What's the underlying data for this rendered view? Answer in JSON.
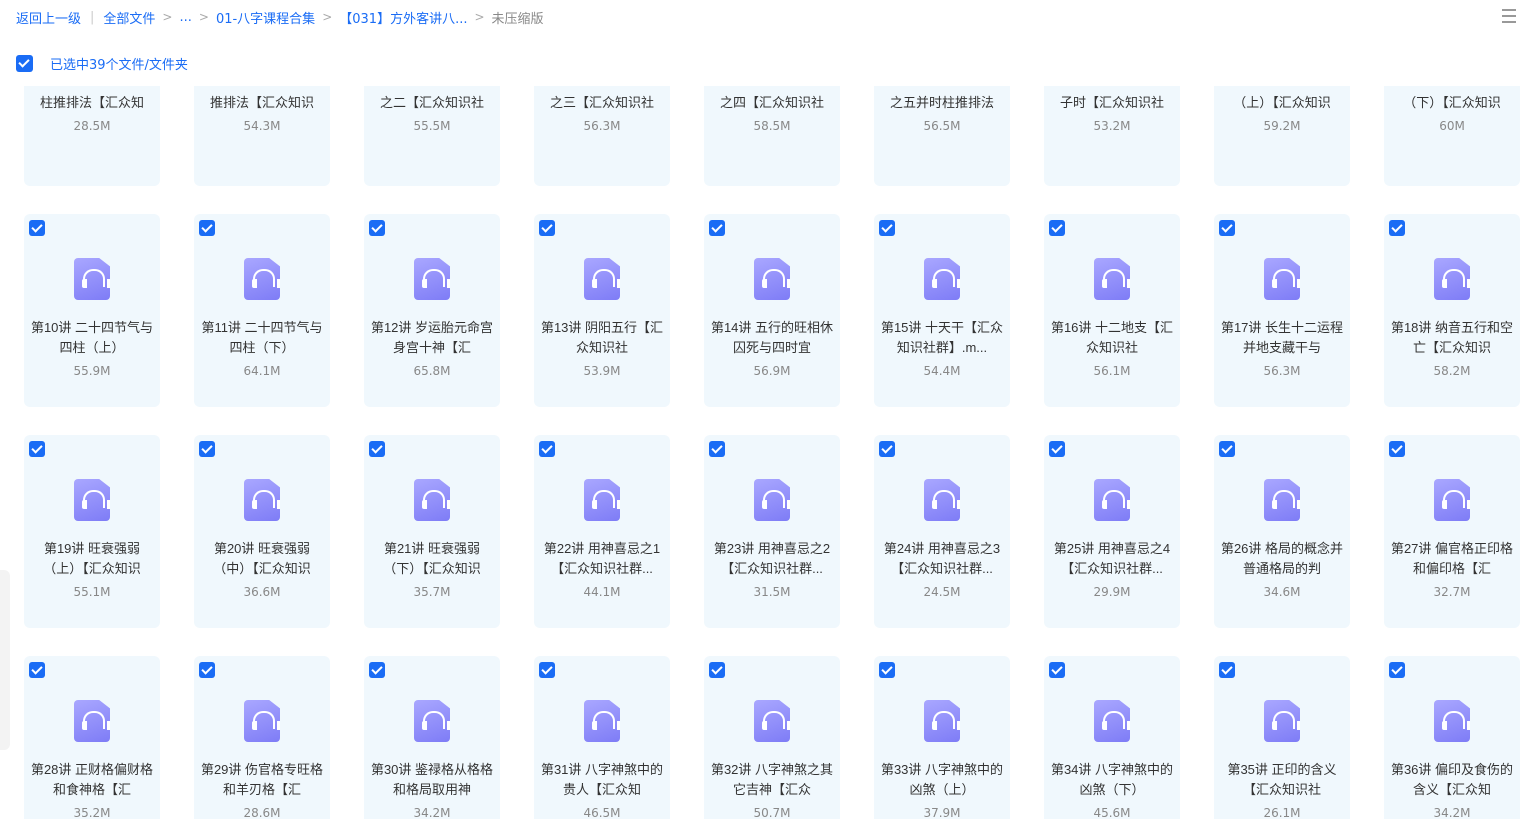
{
  "breadcrumb": {
    "back": "返回上一级",
    "items": [
      "全部文件",
      "...",
      "01-八字课程合集",
      "【031】方外客讲八...",
      "未压缩版"
    ]
  },
  "selection": {
    "text": "已选中39个文件/文件夹"
  },
  "files": [
    {
      "name": "柱推排法【汇众知",
      "size": "28.5M"
    },
    {
      "name": "推排法【汇众知识",
      "size": "54.3M"
    },
    {
      "name": "之二【汇众知识社",
      "size": "55.5M"
    },
    {
      "name": "之三【汇众知识社",
      "size": "56.3M"
    },
    {
      "name": "之四【汇众知识社",
      "size": "58.5M"
    },
    {
      "name": "之五并时柱推排法",
      "size": "56.5M"
    },
    {
      "name": "子时【汇众知识社",
      "size": "53.2M"
    },
    {
      "name": "（上）【汇众知识",
      "size": "59.2M"
    },
    {
      "name": "（下）【汇众知识",
      "size": "60M"
    },
    {
      "name": "第10讲 二十四节气与四柱（上）",
      "size": "55.9M"
    },
    {
      "name": "第11讲 二十四节气与四柱（下）",
      "size": "64.1M"
    },
    {
      "name": "第12讲 岁运胎元命宫身宫十神【汇",
      "size": "65.8M"
    },
    {
      "name": "第13讲 阴阳五行【汇众知识社",
      "size": "53.9M"
    },
    {
      "name": "第14讲 五行的旺相休囚死与四时宜",
      "size": "56.9M"
    },
    {
      "name": "第15讲 十天干【汇众知识社群】.m...",
      "size": "54.4M"
    },
    {
      "name": "第16讲 十二地支【汇众知识社",
      "size": "56.1M"
    },
    {
      "name": "第17讲 长生十二运程并地支藏干与",
      "size": "56.3M"
    },
    {
      "name": "第18讲 纳音五行和空亡【汇众知识",
      "size": "58.2M"
    },
    {
      "name": "第19讲 旺衰强弱（上）【汇众知识",
      "size": "55.1M"
    },
    {
      "name": "第20讲 旺衰强弱（中）【汇众知识",
      "size": "36.6M"
    },
    {
      "name": "第21讲 旺衰强弱（下）【汇众知识",
      "size": "35.7M"
    },
    {
      "name": "第22讲 用神喜忌之1【汇众知识社群...",
      "size": "44.1M"
    },
    {
      "name": "第23讲 用神喜忌之2【汇众知识社群...",
      "size": "31.5M"
    },
    {
      "name": "第24讲 用神喜忌之3【汇众知识社群...",
      "size": "24.5M"
    },
    {
      "name": "第25讲 用神喜忌之4【汇众知识社群...",
      "size": "29.9M"
    },
    {
      "name": "第26讲 格局的概念并普通格局的判",
      "size": "34.6M"
    },
    {
      "name": "第27讲 偏官格正印格和偏印格【汇",
      "size": "32.7M"
    },
    {
      "name": "第28讲 正财格偏财格和食神格【汇",
      "size": "35.2M"
    },
    {
      "name": "第29讲 伤官格专旺格和羊刃格【汇",
      "size": "28.6M"
    },
    {
      "name": "第30讲 鉴禄格从格格和格局取用神",
      "size": "34.2M"
    },
    {
      "name": "第31讲 八字神煞中的贵人【汇众知",
      "size": "46.5M"
    },
    {
      "name": "第32讲 八字神煞之其它吉神【汇众",
      "size": "50.7M"
    },
    {
      "name": "第33讲 八字神煞中的凶煞（上）",
      "size": "37.9M"
    },
    {
      "name": "第34讲 八字神煞中的凶煞（下）",
      "size": "45.6M"
    },
    {
      "name": "第35讲 正印的含义【汇众知识社",
      "size": "26.1M"
    },
    {
      "name": "第36讲 偏印及食伤的含义【汇众知",
      "size": "34.2M"
    }
  ]
}
